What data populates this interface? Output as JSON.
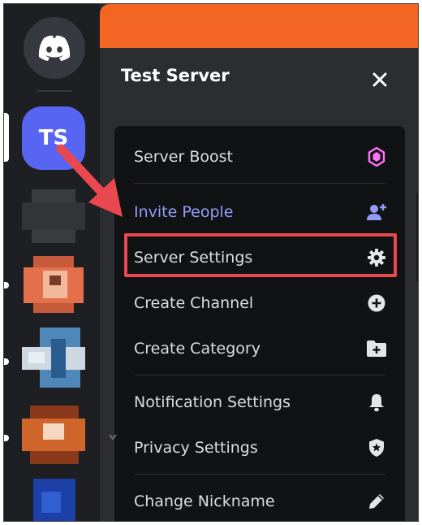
{
  "server": {
    "name": "Test Server",
    "initials": "TS"
  },
  "menu": {
    "items": [
      {
        "label": "Server Boost",
        "icon": "boost-gem-icon"
      },
      {
        "label": "Invite People",
        "icon": "add-person-icon"
      },
      {
        "label": "Server Settings",
        "icon": "gear-icon"
      },
      {
        "label": "Create Channel",
        "icon": "plus-circle-icon"
      },
      {
        "label": "Create Category",
        "icon": "folder-plus-icon"
      },
      {
        "label": "Notification Settings",
        "icon": "bell-icon"
      },
      {
        "label": "Privacy Settings",
        "icon": "shield-star-icon"
      },
      {
        "label": "Change Nickname",
        "icon": "pencil-icon"
      }
    ]
  },
  "colors": {
    "blurple": "#5865f2",
    "invite": "#949cf7",
    "boost": "#ff73fa",
    "highlight": "#e8484e",
    "banner": "#f26522"
  }
}
